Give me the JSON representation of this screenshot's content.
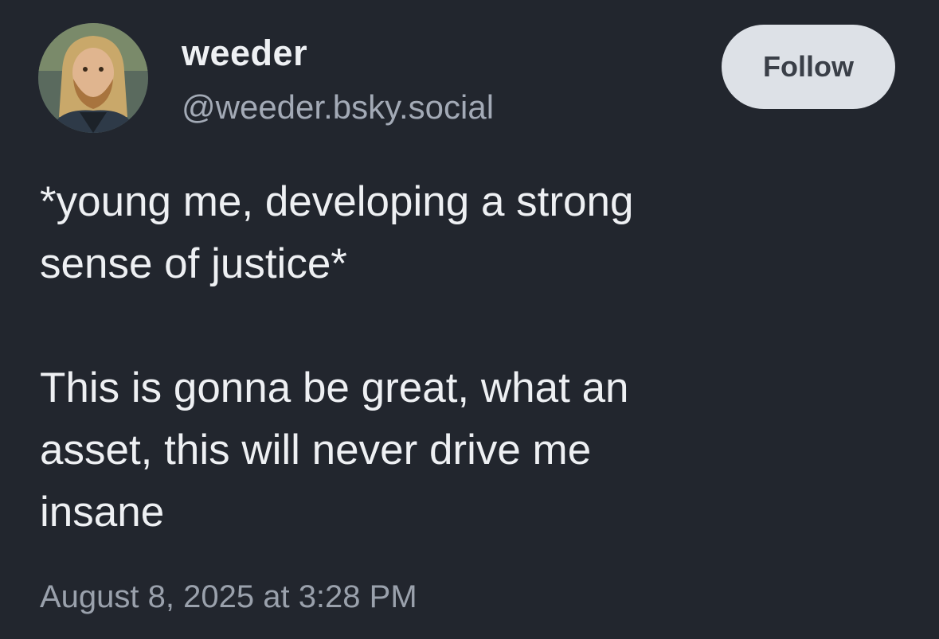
{
  "author": {
    "display_name": "weeder",
    "handle": "@weeder.bsky.social",
    "avatar_icon": "user-avatar"
  },
  "follow_button": {
    "label": "Follow"
  },
  "post": {
    "lines": [
      "*young me, developing a strong",
      "sense of justice*",
      "This is gonna be great, what an",
      "asset, this will never drive me",
      "insane"
    ],
    "timestamp": "August 8, 2025 at 3:28 PM"
  },
  "colors": {
    "background": "#22262e",
    "text_primary": "#eef0f3",
    "text_secondary": "#a3aab6",
    "button_bg": "#dde1e7",
    "button_text": "#3a3f48"
  }
}
